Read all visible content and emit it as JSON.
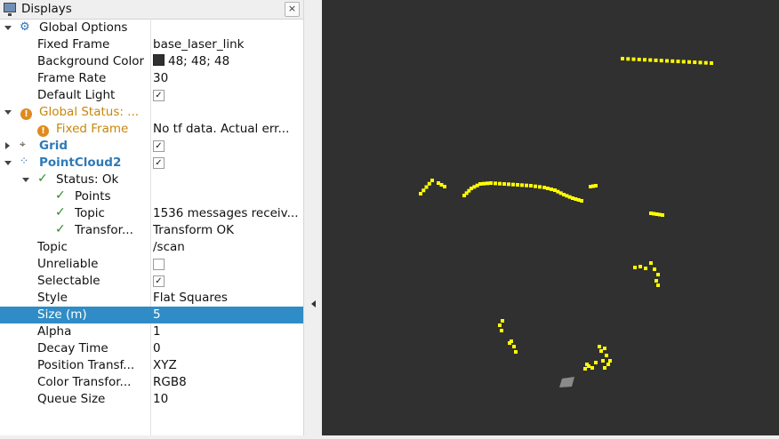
{
  "panel": {
    "title": "Displays",
    "close_icon": "×"
  },
  "tree": {
    "global_options": {
      "label": "Global Options",
      "fixed_frame": {
        "label": "Fixed Frame",
        "value": "base_laser_link"
      },
      "background_color": {
        "label": "Background Color",
        "value": "48; 48; 48",
        "color": "#303030"
      },
      "frame_rate": {
        "label": "Frame Rate",
        "value": "30"
      },
      "default_light": {
        "label": "Default Light",
        "checked": true
      }
    },
    "global_status": {
      "label": "Global Status: ...",
      "fixed_frame": {
        "label": "Fixed Frame",
        "value": "No tf data.  Actual err..."
      }
    },
    "grid": {
      "label": "Grid",
      "checked": true
    },
    "pointcloud2": {
      "label": "PointCloud2",
      "checked": true,
      "status": {
        "label": "Status: Ok",
        "points": {
          "label": "Points"
        },
        "topic": {
          "label": "Topic",
          "value": "1536 messages receiv..."
        },
        "transform": {
          "label": "Transfor...",
          "value": "Transform OK"
        }
      },
      "topic": {
        "label": "Topic",
        "value": "/scan"
      },
      "unreliable": {
        "label": "Unreliable",
        "checked": false
      },
      "selectable": {
        "label": "Selectable",
        "checked": true
      },
      "style": {
        "label": "Style",
        "value": "Flat Squares"
      },
      "size": {
        "label": "Size (m)",
        "value": "5"
      },
      "alpha": {
        "label": "Alpha",
        "value": "1"
      },
      "decay_time": {
        "label": "Decay Time",
        "value": "0"
      },
      "position_transformer": {
        "label": "Position Transf...",
        "value": "XYZ"
      },
      "color_transformer": {
        "label": "Color Transfor...",
        "value": "RGB8"
      },
      "queue_size": {
        "label": "Queue Size",
        "value": "10"
      }
    }
  },
  "colors": {
    "selection": "#308cc6",
    "point": "#ffff00",
    "viewport_bg": "#303030",
    "warning": "#e08a1e",
    "ok": "#2e8b2e"
  }
}
